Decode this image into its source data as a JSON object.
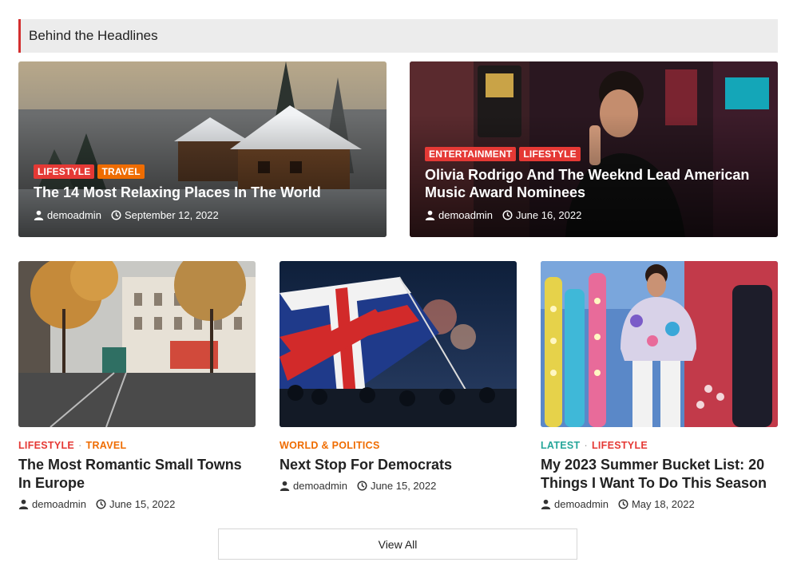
{
  "section": {
    "title": "Behind the Headlines",
    "accent": "#d32f2f"
  },
  "colors": {
    "lifestyle": "#e53935",
    "travel": "#ef6c00",
    "entertainment": "#e53935",
    "world": "#ef6c00",
    "latest": "#26a69a"
  },
  "heroes": [
    {
      "categories": [
        "LIFESTYLE",
        "TRAVEL"
      ],
      "title": "The 14 Most Relaxing Places In The World",
      "author": "demoadmin",
      "date": "September 12, 2022",
      "icons": [
        "user-icon",
        "clock-icon"
      ]
    },
    {
      "categories": [
        "ENTERTAINMENT",
        "LIFESTYLE"
      ],
      "title": "Olivia Rodrigo And The Weeknd Lead American Music Award Nominees",
      "author": "demoadmin",
      "date": "June 16, 2022",
      "icons": [
        "user-icon",
        "clock-icon"
      ]
    }
  ],
  "cards": [
    {
      "categories": [
        "LIFESTYLE",
        "TRAVEL"
      ],
      "title": "The Most Romantic Small Towns In Europe",
      "author": "demoadmin",
      "date": "June 15, 2022"
    },
    {
      "categories": [
        "WORLD & POLITICS"
      ],
      "title": "Next Stop For Democrats",
      "author": "demoadmin",
      "date": "June 15, 2022"
    },
    {
      "categories": [
        "LATEST",
        "LIFESTYLE"
      ],
      "title": "My 2023 Summer Bucket List: 20 Things I Want To Do This Season",
      "author": "demoadmin",
      "date": "May 18, 2022"
    }
  ],
  "view_all": {
    "label": "View All"
  }
}
